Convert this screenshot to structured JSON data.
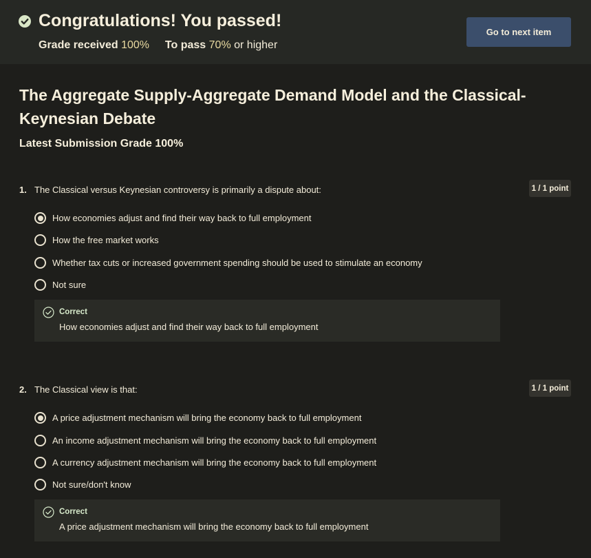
{
  "banner": {
    "title": "Congratulations! You passed!",
    "grade_received_label": "Grade received",
    "grade_received_value": "100%",
    "to_pass_label": "To pass",
    "to_pass_value": "70%",
    "to_pass_suffix": "or higher",
    "next_button": "Go to next item",
    "check_icon": "check-circle-icon"
  },
  "quiz": {
    "title": "The Aggregate Supply-Aggregate Demand Model and the Classical-Keynesian Debate",
    "latest_grade": "Latest Submission Grade 100%"
  },
  "questions": [
    {
      "number": "1.",
      "text": "The Classical versus Keynesian controversy is primarily a dispute about:",
      "points": "1 / 1 point",
      "options": [
        {
          "label": "How economies adjust and find their way back to full employment",
          "selected": true
        },
        {
          "label": "How the free market works",
          "selected": false
        },
        {
          "label": "Whether tax cuts or increased government spending should be used to stimulate an economy",
          "selected": false
        },
        {
          "label": "Not sure",
          "selected": false
        }
      ],
      "feedback": {
        "status": "Correct",
        "text": "How economies adjust and find their way back to full employment"
      }
    },
    {
      "number": "2.",
      "text": "The Classical view is that:",
      "points": "1 / 1 point",
      "options": [
        {
          "label": "A price adjustment mechanism will bring the economy back to full employment",
          "selected": true
        },
        {
          "label": "An income adjustment mechanism will bring the economy back to full employment",
          "selected": false
        },
        {
          "label": "A currency adjustment mechanism will bring the economy  back to full employment",
          "selected": false
        },
        {
          "label": "Not sure/don't know",
          "selected": false
        }
      ],
      "feedback": {
        "status": "Correct",
        "text": "A price adjustment mechanism will bring the economy back to full employment"
      }
    }
  ],
  "colors": {
    "background": "#1e1e1b",
    "banner": "#262824",
    "button": "#3b4e6b",
    "text": "#f3ecd9",
    "accent_value": "#e8d9a0",
    "correct": "#d7eacb"
  }
}
